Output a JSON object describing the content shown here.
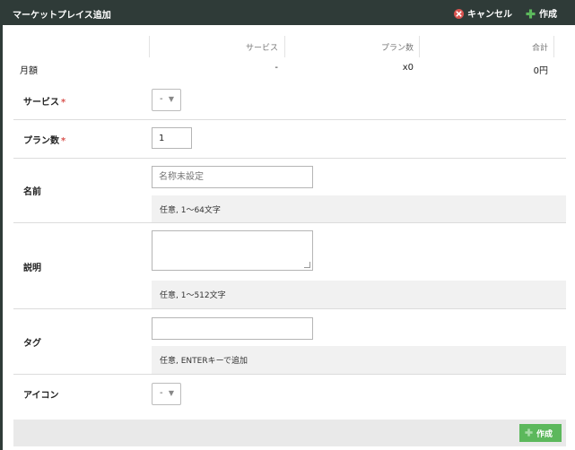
{
  "header": {
    "title": "マーケットプレイス追加",
    "cancel_label": "キャンセル",
    "create_label": "作成",
    "cancel_color": "#d9534f",
    "create_color": "#5cb85c",
    "cancel_icon": "x-circle-icon",
    "create_icon": "plus-icon"
  },
  "summary": {
    "columns": [
      "サービス",
      "プラン数",
      "合計"
    ],
    "row_label": "月額",
    "values": [
      "-",
      "x0",
      "0円"
    ]
  },
  "form": {
    "service": {
      "label": "サービス",
      "required_mark": "*",
      "value": "-"
    },
    "plan_count": {
      "label": "プラン数",
      "required_mark": "*",
      "value": "1"
    },
    "name": {
      "label": "名前",
      "placeholder": "名称未設定",
      "value": "",
      "hint": "任意, 1〜64文字"
    },
    "description": {
      "label": "説明",
      "value": "",
      "hint": "任意, 1〜512文字"
    },
    "tags": {
      "label": "タグ",
      "value": "",
      "hint": "任意, ENTERキーで追加"
    },
    "icon": {
      "label": "アイコン",
      "value": "-"
    }
  },
  "footer": {
    "create_label": "作成"
  }
}
